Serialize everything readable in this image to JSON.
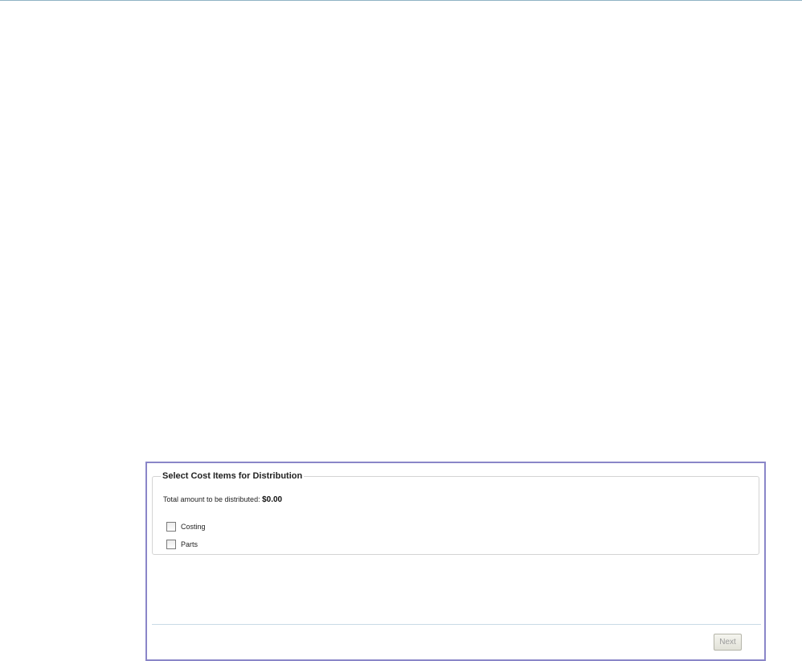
{
  "section": {
    "title": "Select Cost Items for Distribution",
    "total_label": "Total amount to be distributed:",
    "total_value": "$0.00"
  },
  "items": [
    {
      "label": "Costing",
      "checked": false
    },
    {
      "label": "Parts",
      "checked": false
    }
  ],
  "footer": {
    "next_label": "Next"
  },
  "colors": {
    "dialog_border": "#8a86c8",
    "divider": "#c9dbe6",
    "top_rule": "#8fb3c4"
  }
}
